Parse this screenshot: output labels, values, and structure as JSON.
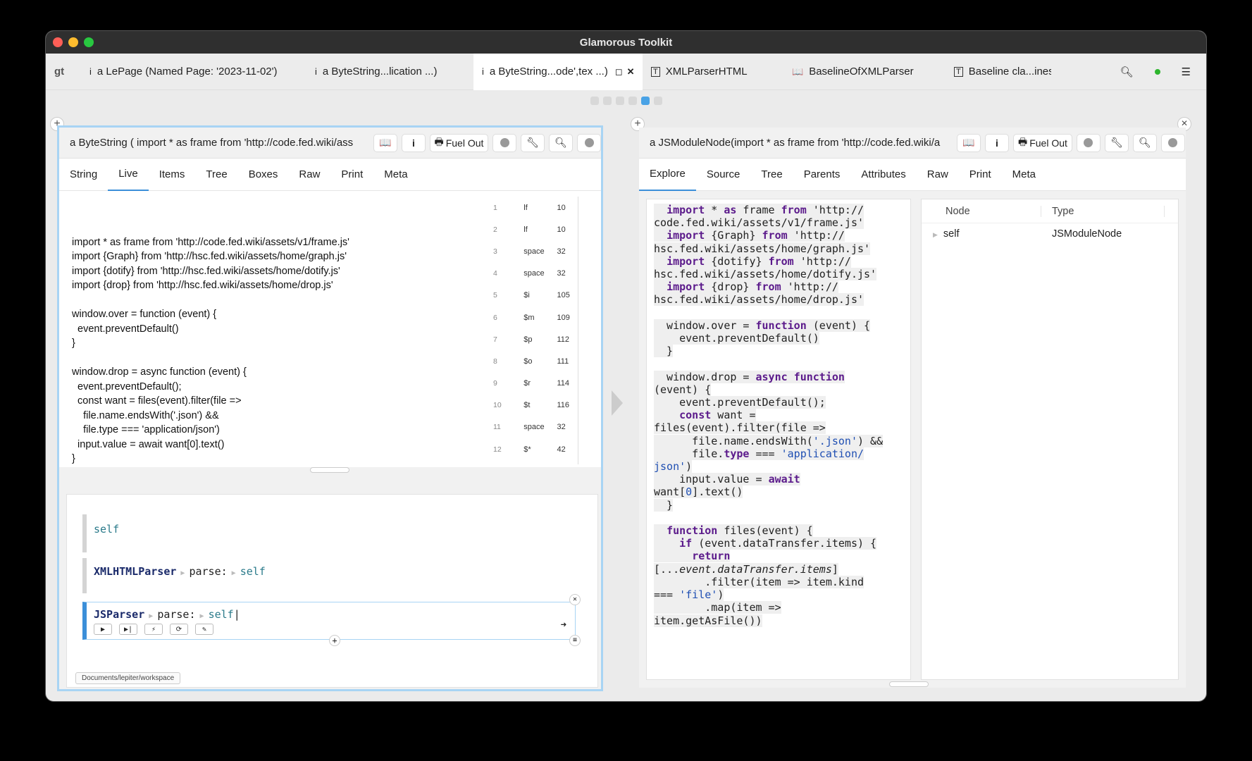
{
  "window": {
    "title": "Glamorous Toolkit"
  },
  "tabs": {
    "logo": "gt",
    "items": [
      {
        "icon": "i",
        "label": "a LePage (Named Page: '2023-11-02')"
      },
      {
        "icon": "i",
        "label": "a ByteString...lication ...)"
      },
      {
        "icon": "i",
        "label": "a ByteString...ode',tex ...)"
      },
      {
        "icon": "T",
        "label": "XMLParserHTML"
      },
      {
        "icon": "book",
        "label": "BaselineOfXMLParser"
      },
      {
        "icon": "T",
        "label": "Baseline cla...ines"
      }
    ]
  },
  "left": {
    "title": "a ByteString (   import * as frame from 'http://code.fed.wiki/ass",
    "fuel_out": "Fuel Out",
    "view_tabs": [
      "String",
      "Live",
      "Items",
      "Tree",
      "Boxes",
      "Raw",
      "Print",
      "Meta"
    ],
    "live_text": "\nimport * as frame from 'http://code.fed.wiki/assets/v1/frame.js'\nimport {Graph} from 'http://hsc.fed.wiki/assets/home/graph.js'\nimport {dotify} from 'http://hsc.fed.wiki/assets/home/dotify.js'\nimport {drop} from 'http://hsc.fed.wiki/assets/home/drop.js'\n\nwindow.over = function (event) {\n  event.preventDefault()\n}\n\nwindow.drop = async function (event) {\n  event.preventDefault();\n  const want = files(event).filter(file =>\n    file.name.endsWith('.json') &&\n    file.type === 'application/json')\n  input.value = await want[0].text()\n}",
    "chars": [
      {
        "n": "1",
        "c": "lf",
        "v": "10"
      },
      {
        "n": "2",
        "c": "lf",
        "v": "10"
      },
      {
        "n": "3",
        "c": "space",
        "v": "32"
      },
      {
        "n": "4",
        "c": "space",
        "v": "32"
      },
      {
        "n": "5",
        "c": "$i",
        "v": "105"
      },
      {
        "n": "6",
        "c": "$m",
        "v": "109"
      },
      {
        "n": "7",
        "c": "$p",
        "v": "112"
      },
      {
        "n": "8",
        "c": "$o",
        "v": "111"
      },
      {
        "n": "9",
        "c": "$r",
        "v": "114"
      },
      {
        "n": "10",
        "c": "$t",
        "v": "116"
      },
      {
        "n": "11",
        "c": "space",
        "v": "32"
      },
      {
        "n": "12",
        "c": "$*",
        "v": "42"
      }
    ],
    "snippets": {
      "s1_self": "self",
      "s2_class": "XMLHTMLParser",
      "s2_msg": "parse:",
      "s2_arg": "self",
      "s3_class": "JSParser",
      "s3_msg": "parse:",
      "s3_arg": "self"
    },
    "workspace_path": "Documents/lepiter/workspace"
  },
  "right": {
    "title": "a JSModuleNode(import * as frame from 'http://code.fed.wiki/a",
    "fuel_out": "Fuel Out",
    "view_tabs": [
      "Explore",
      "Source",
      "Tree",
      "Parents",
      "Attributes",
      "Raw",
      "Print",
      "Meta"
    ],
    "table": {
      "headers": [
        "Node",
        "Type"
      ],
      "rows": [
        {
          "node": "self",
          "type": "JSModuleNode"
        }
      ]
    }
  },
  "colors": {
    "accent": "#3b8fd9",
    "keyword": "#5b1a8b",
    "string": "#1f4fb3"
  }
}
